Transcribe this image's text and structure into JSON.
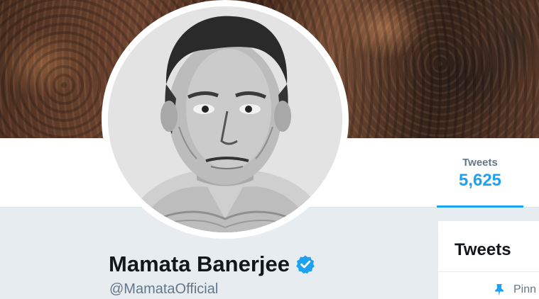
{
  "profile": {
    "name": "Mamata Banerjee",
    "handle": "@MamataOfficial",
    "verified_icon": "verified-badge-icon",
    "accent_color": "#1da1f2"
  },
  "stats": {
    "tweets_label": "Tweets",
    "tweets_count": "5,625"
  },
  "timeline": {
    "heading": "Tweets",
    "pinned_label": "Pinn",
    "pinned_icon": "pin-icon"
  }
}
